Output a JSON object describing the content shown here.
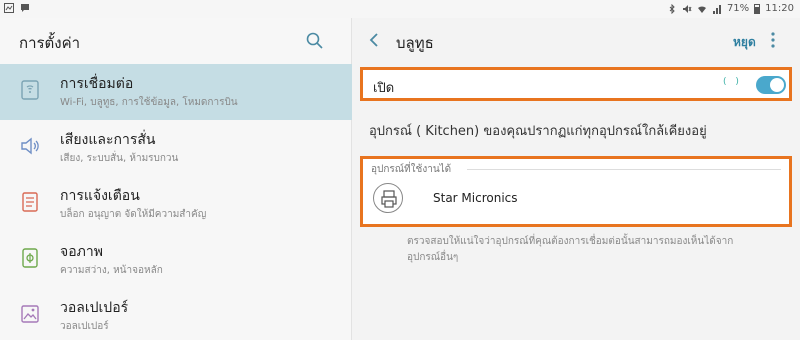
{
  "status_bar": {
    "battery": "71%",
    "time": "11:20"
  },
  "left": {
    "title": "การตั้งค่า",
    "items": [
      {
        "title": "การเชื่อมต่อ",
        "subtitle": "Wi-Fi, บลูทูธ, การใช้ข้อมูล, โหมดการบิน",
        "icon": "connections-icon",
        "active": true
      },
      {
        "title": "เสียงและการสั่น",
        "subtitle": "เสียง, ระบบสั่น, ห้ามรบกวน",
        "icon": "speaker-icon",
        "active": false
      },
      {
        "title": "การแจ้งเตือน",
        "subtitle": "บล็อก อนุญาต จัดให้มีความสำคัญ",
        "icon": "notifications-icon",
        "active": false
      },
      {
        "title": "จอภาพ",
        "subtitle": "ความสว่าง, หน้าจอหลัก",
        "icon": "display-icon",
        "active": false
      },
      {
        "title": "วอลเปเปอร์",
        "subtitle": "วอลเปเปอร์",
        "icon": "wallpaper-icon",
        "active": false
      }
    ]
  },
  "right": {
    "title": "บลูทูธ",
    "stop_label": "หยุด",
    "on_label": "เปิด",
    "scan_anim": "( )",
    "toggle_on": true,
    "device_name_text": "อุปกรณ์ (     Kitchen) ของคุณปรากฏแก่ทุกอุปกรณ์ใกล้เคียงอยู่",
    "available_header": "อุปกรณ์ที่ใช้งานได้",
    "devices": [
      {
        "name": "Star Micronics",
        "icon": "printer-icon"
      }
    ],
    "hint": "ตรวจสอบให้แน่ใจว่าอุปกรณ์ที่คุณต้องการเชื่อมต่อนั้นสามารถมองเห็นได้จากอุปกรณ์อื่นๆ"
  },
  "colors": {
    "accent": "#4aa8cc",
    "highlight_border": "#e8741f",
    "active_item_bg": "#c5dde4"
  }
}
